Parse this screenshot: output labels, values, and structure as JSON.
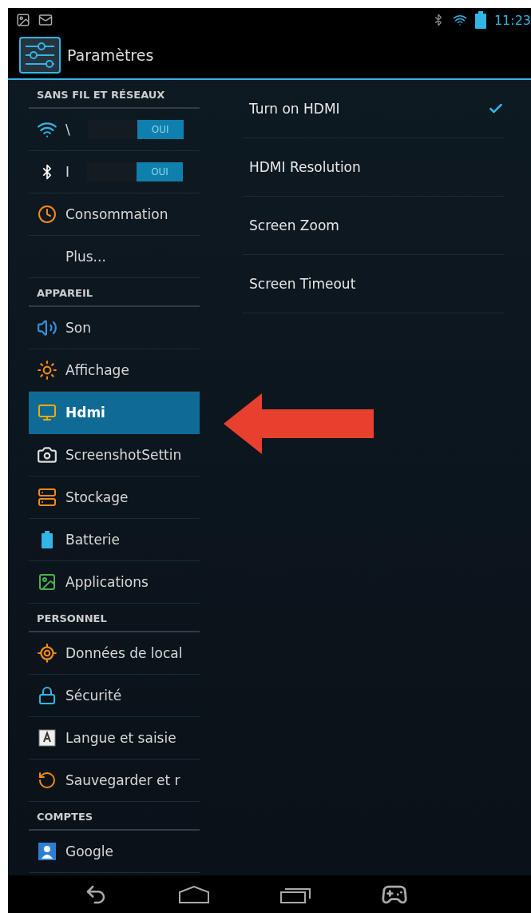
{
  "status_bar": {
    "time": "11:23"
  },
  "action_bar": {
    "title": "Paramètres"
  },
  "sidebar": {
    "items": [
      {
        "kind": "header",
        "label": "SANS FIL ET RÉSEAUX"
      },
      {
        "kind": "toggle",
        "label": "\\",
        "switch_label": "OUI",
        "on": true,
        "selected": false
      },
      {
        "kind": "toggle",
        "label": "I",
        "switch_label": "OUI",
        "on": true,
        "selected": false
      },
      {
        "kind": "item",
        "label": "Consommation",
        "selected": false
      },
      {
        "kind": "item",
        "label": "Plus...",
        "selected": false
      },
      {
        "kind": "header",
        "label": "APPAREIL"
      },
      {
        "kind": "item",
        "label": "Son",
        "selected": false
      },
      {
        "kind": "item",
        "label": "Affichage",
        "selected": false
      },
      {
        "kind": "item",
        "label": "Hdmi",
        "selected": true
      },
      {
        "kind": "item",
        "label": "ScreenshotSettin",
        "selected": false
      },
      {
        "kind": "item",
        "label": "Stockage",
        "selected": false
      },
      {
        "kind": "item",
        "label": "Batterie",
        "selected": false
      },
      {
        "kind": "item",
        "label": "Applications",
        "selected": false
      },
      {
        "kind": "header",
        "label": "PERSONNEL"
      },
      {
        "kind": "item",
        "label": "Données de local",
        "selected": false
      },
      {
        "kind": "item",
        "label": "Sécurité",
        "selected": false
      },
      {
        "kind": "item",
        "label": "Langue et saisie",
        "selected": false
      },
      {
        "kind": "item",
        "label": "Sauvegarder et r",
        "selected": false
      },
      {
        "kind": "header",
        "label": "COMPTES"
      },
      {
        "kind": "item",
        "label": "Google",
        "selected": false
      }
    ]
  },
  "settings": [
    {
      "label": "Turn on HDMI",
      "checked": true
    },
    {
      "label": "HDMI Resolution",
      "checked": false
    },
    {
      "label": "Screen Zoom",
      "checked": false
    },
    {
      "label": "Screen Timeout",
      "checked": false
    }
  ]
}
